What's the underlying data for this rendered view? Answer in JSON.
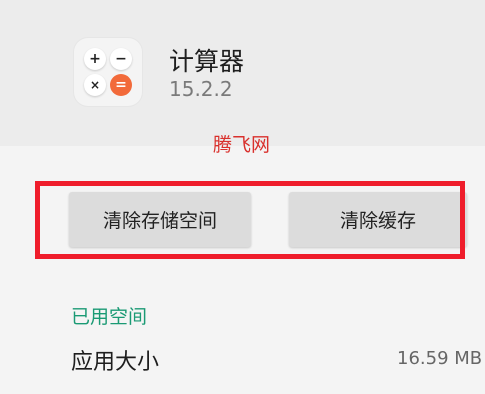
{
  "app": {
    "name": "计算器",
    "version": "15.2.2",
    "icon": {
      "name": "calculator-icon",
      "keys": [
        "+",
        "−",
        "×",
        "="
      ],
      "accent_color": "#f26a3a"
    }
  },
  "watermark": "腾飞网",
  "actions": {
    "clear_storage": "清除存储空间",
    "clear_cache": "清除缓存"
  },
  "highlight_color": "#ef1d2b",
  "storage": {
    "section_title": "已用空间",
    "app_size_label": "应用大小",
    "app_size_value": "16.59 MB"
  }
}
